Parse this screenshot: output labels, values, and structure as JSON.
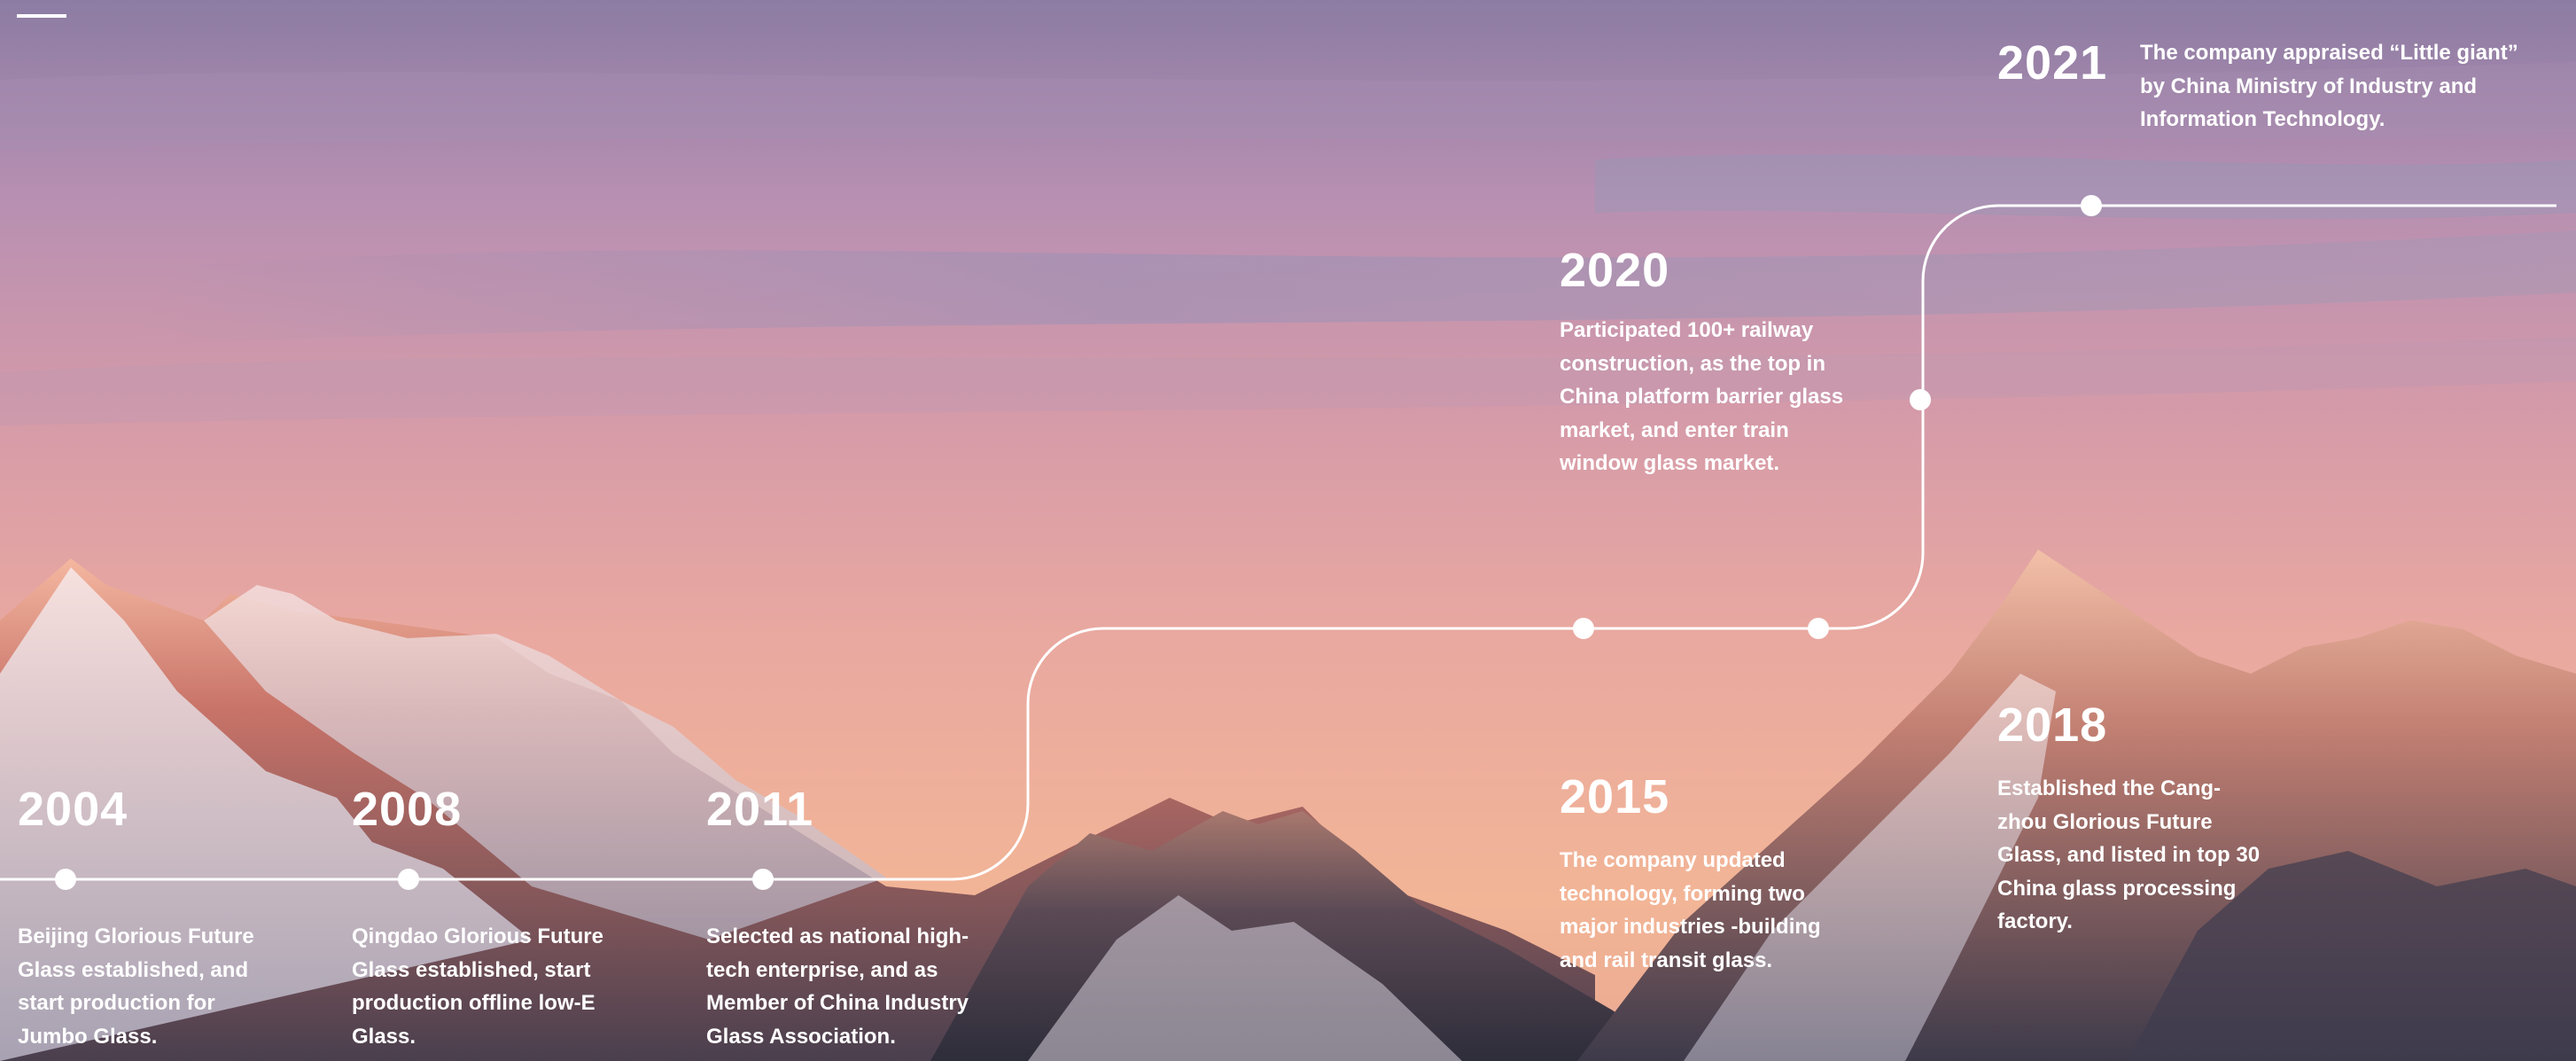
{
  "timeline": {
    "milestones": [
      {
        "year": "2004",
        "text": "Beijing Glorious Future Glass established, and start production for Jumbo Glass."
      },
      {
        "year": "2008",
        "text": "Qingdao Glorious Future Glass established, start production offline low-E Glass."
      },
      {
        "year": "2011",
        "text": " Selected as national high-tech enterprise, and as Member of China Industry Glass Association."
      },
      {
        "year": "2015",
        "text": " The company updated technology, forming two major industries -building and rail transit glass."
      },
      {
        "year": "2018",
        "text": " Established the Cang-zhou Glorious Future Glass, and listed in top 30 China glass processing factory."
      },
      {
        "year": "2020",
        "text": "Participated 100+ railway construction, as the top in China platform barrier glass market, and enter train window glass market."
      },
      {
        "year": "2021",
        "text": "The company appraised “Little giant” by China Ministry of Industry and Information Technology."
      }
    ]
  },
  "colors": {
    "text": "#ffffff",
    "line": "#ffffff",
    "sky_top": "#8f7da4",
    "sky_mid": "#e7a6a6",
    "horizon": "#f3b59a",
    "mountain_dark": "#3a3a4c",
    "snow": "#e9e3ea"
  }
}
